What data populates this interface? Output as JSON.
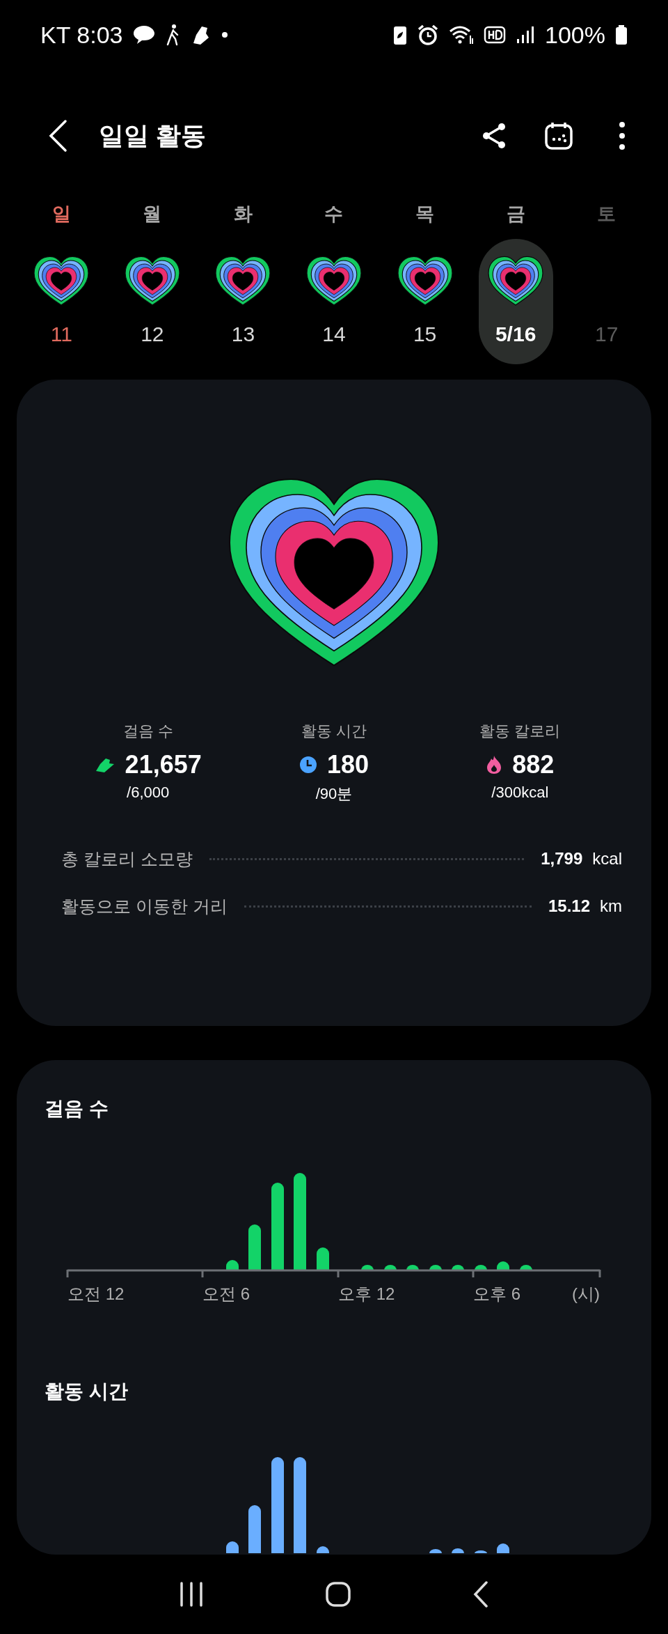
{
  "status_bar": {
    "time": "KT 8:03",
    "battery": "100%"
  },
  "header": {
    "title": "일일 활동"
  },
  "week": [
    {
      "weekday": "일",
      "date": "11",
      "kind": "sunday",
      "selected": false
    },
    {
      "weekday": "월",
      "date": "12",
      "kind": "day",
      "selected": false
    },
    {
      "weekday": "화",
      "date": "13",
      "kind": "day",
      "selected": false
    },
    {
      "weekday": "수",
      "date": "14",
      "kind": "day",
      "selected": false
    },
    {
      "weekday": "목",
      "date": "15",
      "kind": "day",
      "selected": false
    },
    {
      "weekday": "금",
      "date": "5/16",
      "kind": "day",
      "selected": true
    },
    {
      "weekday": "토",
      "date": "17",
      "kind": "future",
      "selected": false
    }
  ],
  "summary": {
    "stats": [
      {
        "kind": "steps",
        "label": "걸음 수",
        "value": "21,657",
        "goal": "/6,000"
      },
      {
        "kind": "time",
        "label": "활동 시간",
        "value": "180",
        "goal": "/90분"
      },
      {
        "kind": "calories",
        "label": "활동 칼로리",
        "value": "882",
        "goal": "/300kcal"
      }
    ],
    "totals": [
      {
        "label": "총 칼로리 소모량",
        "value": "1,799",
        "unit": "kcal"
      },
      {
        "label": "활동으로 이동한 거리",
        "value": "15.12",
        "unit": "km"
      }
    ]
  },
  "steps_chart": {
    "title": "걸음 수",
    "axis_labels": [
      "오전 12",
      "오전 6",
      "오후 12",
      "오후 6",
      "(시)"
    ]
  },
  "active_time_chart": {
    "title": "활동 시간"
  }
}
